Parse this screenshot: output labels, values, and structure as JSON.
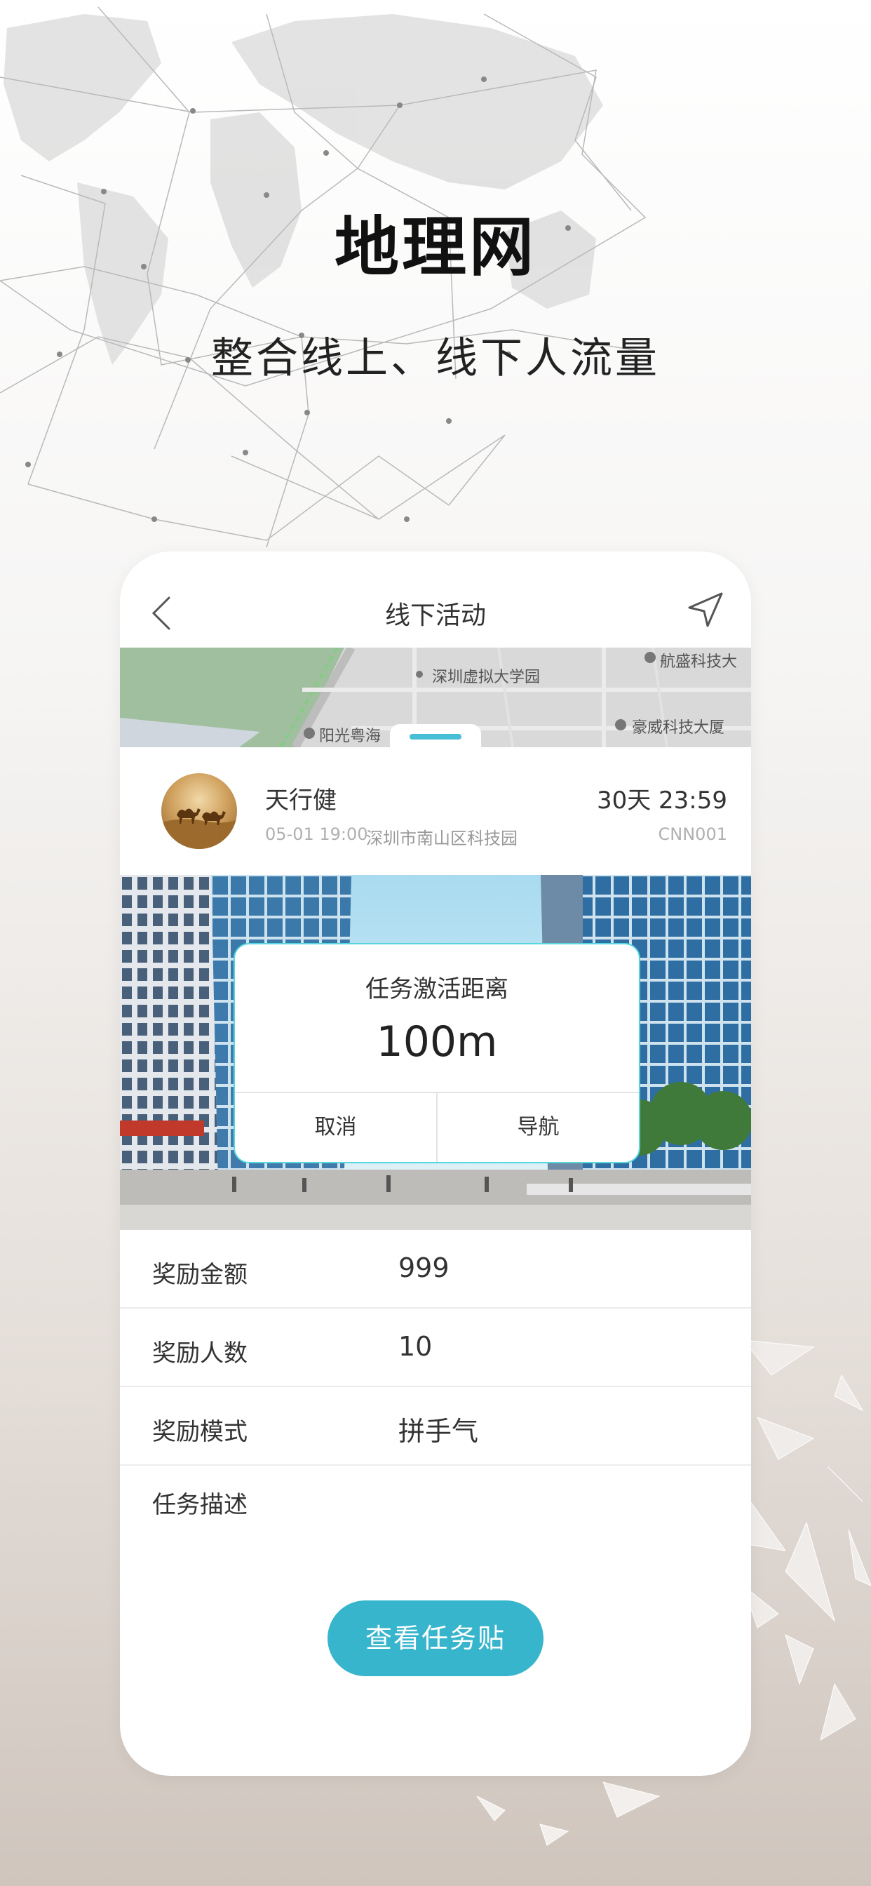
{
  "hero": {
    "title": "地理网",
    "subtitle": "整合线上、线下人流量"
  },
  "nav": {
    "title": "线下活动",
    "back_icon": "chevron-left-icon",
    "send_icon": "navigation-arrow-icon"
  },
  "map": {
    "labels": [
      "深圳虚拟大学园",
      "航盛科技大",
      "阳光粤海",
      "豪威科技大厦"
    ]
  },
  "event": {
    "name": "天行健",
    "date": "05-01 19:00",
    "address": "深圳市南山区科技园",
    "countdown": "30天 23:59",
    "code": "CNN001"
  },
  "dialog": {
    "title": "任务激活距离",
    "value": "100m",
    "cancel_label": "取消",
    "navigate_label": "导航"
  },
  "details": {
    "reward_amount_label": "奖励金额",
    "reward_amount_value": "999",
    "reward_count_label": "奖励人数",
    "reward_count_value": "10",
    "reward_mode_label": "奖励模式",
    "reward_mode_value": "拼手气",
    "description_label": "任务描述",
    "description_value": ""
  },
  "cta": {
    "label": "查看任务贴"
  },
  "colors": {
    "accent": "#37b5cc",
    "dialog_border": "#55d7dd",
    "map_handle": "#47bfd6"
  }
}
